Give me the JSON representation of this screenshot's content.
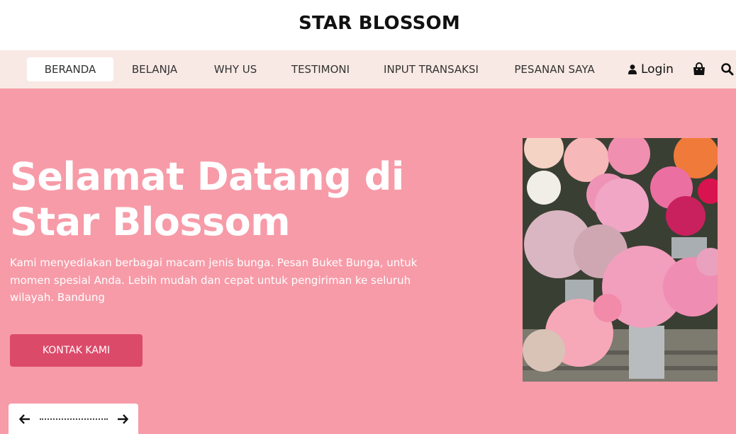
{
  "brand": {
    "title": "STAR BLOSSOM"
  },
  "nav": {
    "items": [
      {
        "label": "BERANDA",
        "active": true
      },
      {
        "label": "BELANJA"
      },
      {
        "label": "WHY US"
      },
      {
        "label": "TESTIMONI"
      },
      {
        "label": "INPUT TRANSAKSI"
      },
      {
        "label": "PESANAN SAYA"
      }
    ],
    "login_label": "Login"
  },
  "hero": {
    "title": "Selamat Datang di Star Blossom",
    "description": "Kami menyediakan berbagai macam jenis bunga. Pesan Buket Bunga, untuk momen spesial Anda. Lebih mudah dan cepat untuk pengiriman ke seluruh wilayah. Bandung",
    "cta_label": "KONTAK KAMI"
  },
  "colors": {
    "hero_bg": "#f79ba8",
    "nav_bg": "#f8e9e4",
    "cta_bg": "#dc4a6a"
  },
  "icons": [
    "user-icon",
    "shopping-bag-icon",
    "search-icon",
    "arrow-left-icon",
    "arrow-right-icon"
  ]
}
